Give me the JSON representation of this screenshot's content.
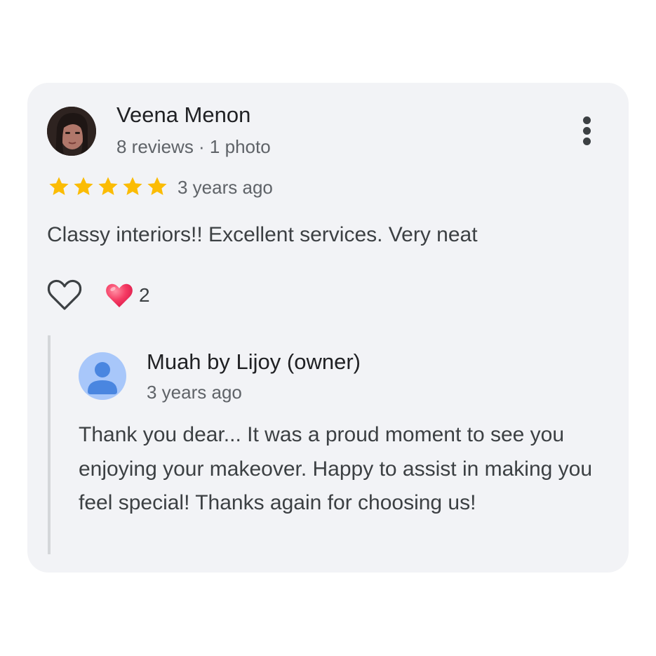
{
  "review": {
    "author": "Veena Menon",
    "author_meta": "8 reviews · 1 photo",
    "rating": 5,
    "time": "3 years ago",
    "text": "Classy interiors!! Excellent services. Very neat",
    "reaction_count": "2"
  },
  "reply": {
    "author": "Muah by Lijoy (owner)",
    "time": "3 years ago",
    "text": "Thank you dear... It was a proud moment to see you enjoying your makeover. Happy to assist in making you feel special! Thanks again for choosing us!"
  },
  "icons": {
    "more": "more-vert-icon",
    "like": "heart-outline-icon",
    "reaction": "heart-filled-icon",
    "star": "star-icon",
    "owner_avatar": "person-icon"
  },
  "colors": {
    "card_bg": "#f2f3f6",
    "star": "#fbbc04",
    "heart": "#f0325a",
    "owner_avatar_bg": "#a8c7fa",
    "owner_avatar_fg": "#4a86e0"
  }
}
